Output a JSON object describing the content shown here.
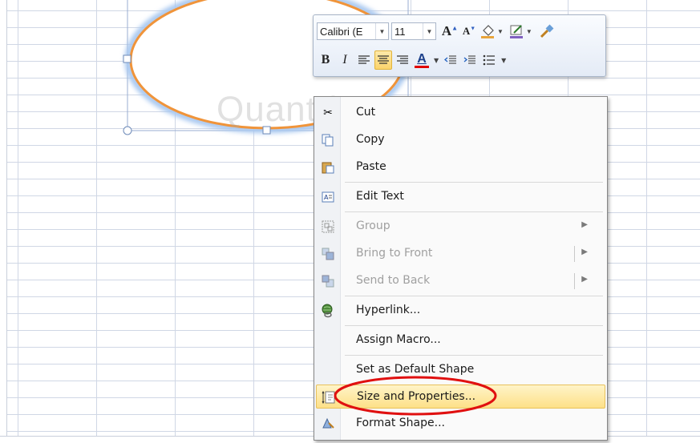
{
  "mini_toolbar": {
    "font_name": "Calibri (E",
    "font_size": "11",
    "grow_font_icon": "increase-font-size-icon",
    "shrink_font_icon": "decrease-font-size-icon",
    "bold_label": "B",
    "italic_label": "I",
    "font_color_label": "A",
    "font_color": "#e00000",
    "fill_color": "#e8a43a",
    "line_color": "#8060c0"
  },
  "context_menu": {
    "items": [
      {
        "label": "Cut",
        "icon": "scissors-icon",
        "disabled": false
      },
      {
        "label": "Copy",
        "icon": "copy-icon",
        "disabled": false
      },
      {
        "label": "Paste",
        "icon": "paste-icon",
        "disabled": false
      },
      {
        "label": "Edit Text",
        "icon": "edit-text-icon",
        "disabled": false
      },
      {
        "label": "Group",
        "icon": "group-icon",
        "disabled": true
      },
      {
        "label": "Bring to Front",
        "icon": "bring-to-front-icon",
        "disabled": true
      },
      {
        "label": "Send to Back",
        "icon": "send-to-back-icon",
        "disabled": true
      },
      {
        "label": "Hyperlink...",
        "icon": "hyperlink-icon",
        "disabled": false
      },
      {
        "label": "Assign Macro...",
        "icon": "",
        "disabled": false
      },
      {
        "label": "Set as Default Shape",
        "icon": "",
        "disabled": false
      },
      {
        "label": "Size and Properties...",
        "icon": "size-properties-icon",
        "disabled": false,
        "highlighted": true
      },
      {
        "label": "Format Shape...",
        "icon": "format-shape-icon",
        "disabled": false
      }
    ]
  },
  "watermark": "Quantrimang",
  "colors": {
    "shape_outline": "#f0943a",
    "shape_glow": "#a8c8f0",
    "menu_highlight": "#fde088",
    "annotation_ellipse": "#e01010",
    "grid_line": "#d0d7e5"
  }
}
